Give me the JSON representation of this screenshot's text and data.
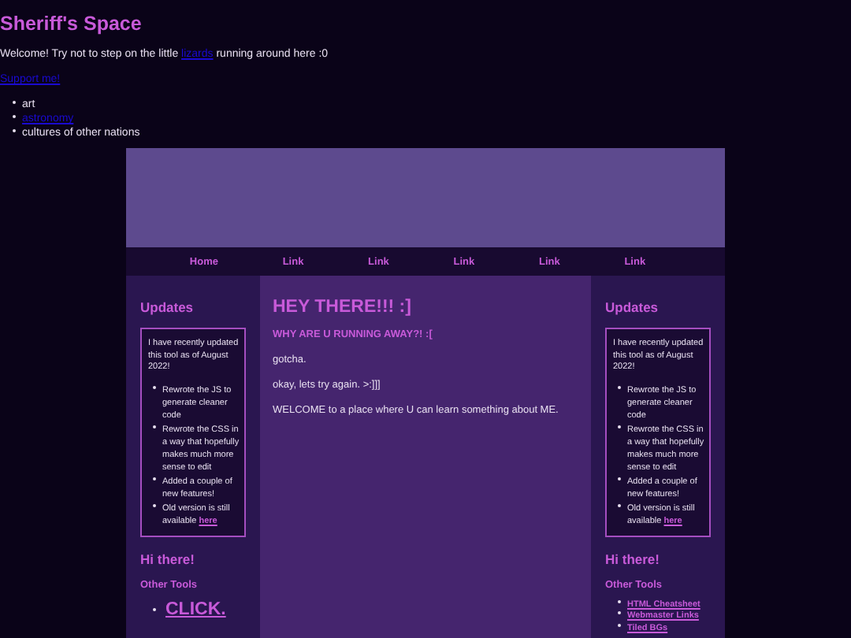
{
  "site_title": "Sheriff's Space",
  "intro": {
    "before": "Welcome! Try not to step on the little",
    "link": "lizards",
    "after": "running around here :0"
  },
  "support_link": "Support me!",
  "interests": [
    {
      "kind": "text",
      "label": "art"
    },
    {
      "kind": "link",
      "label": "astronomy"
    },
    {
      "kind": "text",
      "label": "cultures of other nations"
    }
  ],
  "nav": [
    "Home",
    "Link",
    "Link",
    "Link",
    "Link",
    "Link"
  ],
  "left_sidebar": {
    "heading": "Updates",
    "updates": {
      "intro": "I have recently updated this tool as of August 2022!",
      "items": [
        {
          "text": "Rewrote the JS to generate cleaner code"
        },
        {
          "text": "Rewrote the CSS in a way that hopefully makes much more sense to edit"
        },
        {
          "text": "Added a couple of new features!"
        },
        {
          "text": "Old version is still available",
          "link": "here"
        }
      ]
    },
    "greeting": "Hi there!",
    "tools_heading": "Other Tools",
    "tools": [
      {
        "kind": "large",
        "label": "CLICK."
      }
    ]
  },
  "main": {
    "heading": "HEY THERE!!! :]",
    "subheading": "WHY ARE U RUNNING AWAY?! :[",
    "paragraphs": [
      "gotcha.",
      "okay, lets try again. >:]]]",
      "WELCOME to a place where U can learn something about ME."
    ]
  },
  "right_sidebar": {
    "heading": "Updates",
    "updates": {
      "intro": "I have recently updated this tool as of August 2022!",
      "items": [
        {
          "text": "Rewrote the JS to generate cleaner code"
        },
        {
          "text": "Rewrote the CSS in a way that hopefully makes much more sense to edit"
        },
        {
          "text": "Added a couple of new features!"
        },
        {
          "text": "Old version is still available",
          "link": "here"
        }
      ]
    },
    "greeting": "Hi there!",
    "tools_heading": "Other Tools",
    "tools": [
      {
        "kind": "small",
        "label": "HTML Cheatsheet"
      },
      {
        "kind": "small",
        "label": "Webmaster Links"
      },
      {
        "kind": "small",
        "label": "Tiled BGs"
      }
    ]
  }
}
